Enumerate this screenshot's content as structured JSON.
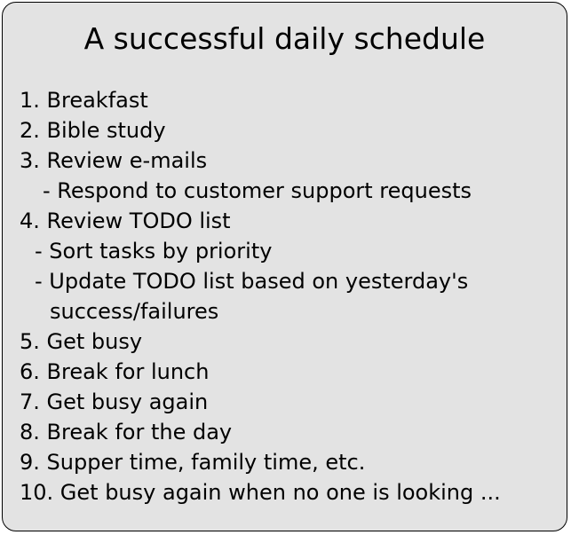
{
  "title": "A successful daily schedule",
  "lines": [
    "1. Breakfast",
    "2. Bible study",
    "3. Review e-mails",
    "   - Respond to customer support requests",
    "4. Review TODO list",
    "  - Sort tasks by priority",
    "  - Update TODO list based on yesterday's",
    "    success/failures",
    "5. Get busy",
    "6. Break for lunch",
    "7. Get busy again",
    "8. Break for the day",
    "9. Supper time, family time, etc.",
    "10. Get busy again when no one is looking ..."
  ],
  "colors": {
    "card_background": "#e3e3e3",
    "border": "#000000",
    "text": "#000000"
  }
}
